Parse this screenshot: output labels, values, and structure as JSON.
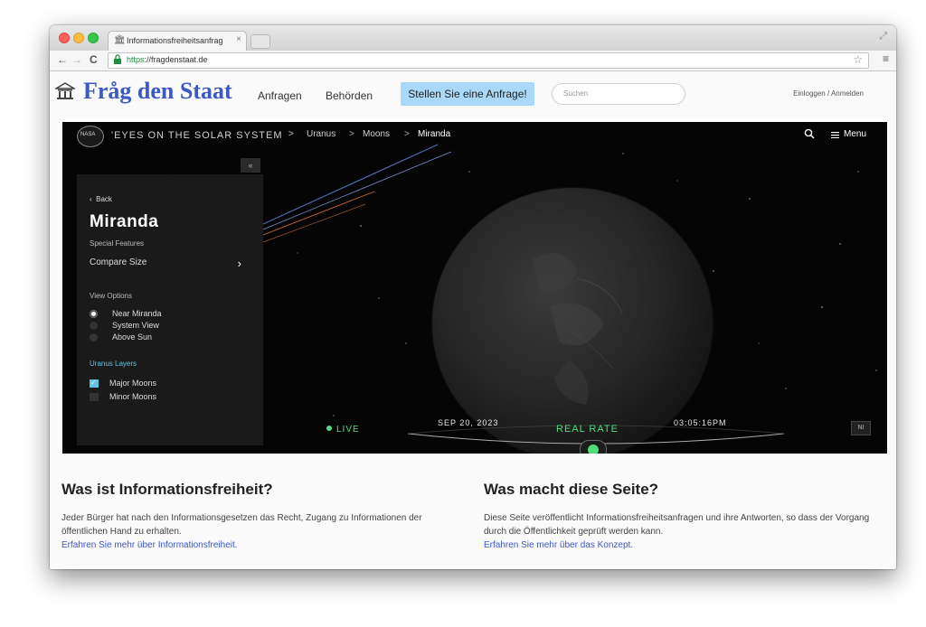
{
  "browser": {
    "tab_title": "Informationsfreiheitsanfrag",
    "tab_close": "×",
    "url_scheme": "https",
    "url_rest": "://fragdenstaat.de",
    "icons": [
      "lock-icon",
      "star-icon",
      "menu-icon",
      "back-arrow-icon",
      "forward-arrow-icon",
      "reload-icon"
    ]
  },
  "site": {
    "logo": "Fråg den Staat",
    "nav": [
      "Anfragen",
      "Behörden"
    ],
    "cta": "Stellen Sie eine Anfrage!",
    "search_placeholder": "Suchen",
    "login": "Einloggen / Anmelden",
    "brand_color": "#3b58c3",
    "cta_color": "#a9d8f8"
  },
  "app": {
    "logo_text": "NASA",
    "title": "'EYES ON THE SOLAR SYSTEM",
    "breadcrumbs": [
      "Uranus",
      "Moons",
      "Miranda"
    ],
    "crumb_sep": ">",
    "menu_label": "Menu",
    "collapse_label": "«",
    "panel": {
      "back": "Back",
      "moon": "Miranda",
      "special_features_label": "Special Features",
      "compare": "Compare Size",
      "view_options_label": "View Options",
      "views": [
        {
          "label": "Near Miranda",
          "selected": true
        },
        {
          "label": "System View",
          "selected": false
        },
        {
          "label": "Above Sun",
          "selected": false
        }
      ],
      "layers_label": "Uranus Layers",
      "layers": [
        {
          "label": "Major Moons",
          "checked": true
        },
        {
          "label": "Minor Moons",
          "checked": false
        }
      ]
    },
    "timeline": {
      "live": "LIVE",
      "date": "SEP 20, 2023",
      "rate": "REAL RATE",
      "time": "03:05:16PM",
      "corner_button": "NI"
    },
    "accent_green": "#4fdc7c",
    "accent_blue": "#5fc4e6"
  },
  "content": {
    "left": {
      "title": "Was ist Informationsfreiheit?",
      "text": "Jeder Bürger hat nach den Informationsgesetzen das Recht, Zugang zu Informationen der öffentlichen Hand zu erhalten.",
      "link": "Erfahren Sie mehr über Informationsfreiheit."
    },
    "right": {
      "title": "Was macht diese Seite?",
      "text": "Diese Seite veröffentlicht Informationsfreiheitsanfragen und ihre Antworten, so dass der Vorgang durch die Öffentlichkeit geprüft werden kann.",
      "link": "Erfahren Sie mehr über das Konzept."
    }
  }
}
